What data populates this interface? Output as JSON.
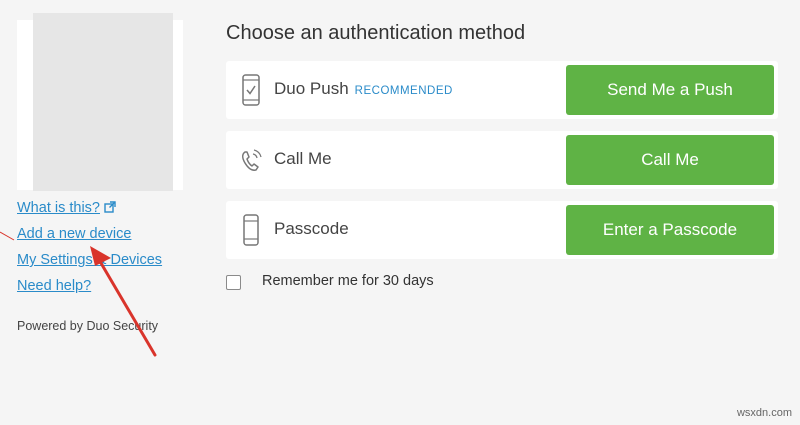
{
  "sidebar": {
    "links": [
      {
        "label": "What is this?",
        "has_external_icon": true
      },
      {
        "label": "Add a new device"
      },
      {
        "label": "My Settings & Devices"
      },
      {
        "label": "Need help?"
      }
    ],
    "powered_by": "Powered by Duo Security"
  },
  "main": {
    "title": "Choose an authentication method",
    "methods": [
      {
        "icon": "phone-check-icon",
        "label": "Duo Push",
        "badge": "RECOMMENDED",
        "button": "Send Me a Push"
      },
      {
        "icon": "phone-call-icon",
        "label": "Call Me",
        "button": "Call Me"
      },
      {
        "icon": "passcode-device-icon",
        "label": "Passcode",
        "button": "Enter a Passcode"
      }
    ],
    "remember": {
      "label": "Remember me for 30 days",
      "checked": false
    }
  },
  "watermark": "wsxdn.com",
  "colors": {
    "accent_green": "#5fb345",
    "link_blue": "#2a8bc9",
    "annotation_red": "#d9342b",
    "background": "#f5f5f5"
  }
}
